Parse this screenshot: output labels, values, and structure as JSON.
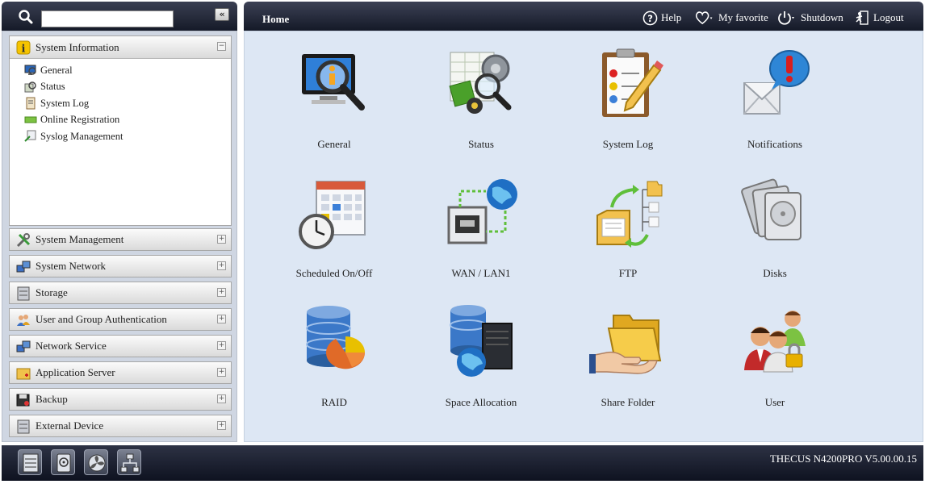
{
  "search": {
    "placeholder": "",
    "value": ""
  },
  "collapse_label": "«",
  "header": {
    "title": "Home",
    "help": "Help",
    "favorite": "My favorite",
    "shutdown": "Shutdown",
    "logout": "Logout"
  },
  "sidebar": {
    "active_section": {
      "label": "System Information",
      "toggle": "−",
      "items": [
        {
          "label": "General",
          "icon": "monitor-info-icon"
        },
        {
          "label": "Status",
          "icon": "status-icon"
        },
        {
          "label": "System Log",
          "icon": "log-icon"
        },
        {
          "label": "Online Registration",
          "icon": "register-icon"
        },
        {
          "label": "Syslog Management",
          "icon": "syslog-icon"
        }
      ]
    },
    "sections": [
      {
        "label": "System Management",
        "toggle": "+",
        "icon": "tools-icon"
      },
      {
        "label": "System Network",
        "toggle": "+",
        "icon": "network-icon"
      },
      {
        "label": "Storage",
        "toggle": "+",
        "icon": "storage-icon"
      },
      {
        "label": "User and Group Authentication",
        "toggle": "+",
        "icon": "users-icon"
      },
      {
        "label": "Network Service",
        "toggle": "+",
        "icon": "network-service-icon"
      },
      {
        "label": "Application Server",
        "toggle": "+",
        "icon": "app-server-icon"
      },
      {
        "label": "Backup",
        "toggle": "+",
        "icon": "backup-icon"
      },
      {
        "label": "External Device",
        "toggle": "+",
        "icon": "external-device-icon"
      }
    ]
  },
  "tiles": [
    {
      "label": "General",
      "icon": "general-icon"
    },
    {
      "label": "Status",
      "icon": "status-icon"
    },
    {
      "label": "System Log",
      "icon": "system-log-icon"
    },
    {
      "label": "Notifications",
      "icon": "notifications-icon"
    },
    {
      "label": "Scheduled On/Off",
      "icon": "schedule-icon"
    },
    {
      "label": "WAN / LAN1",
      "icon": "wan-lan-icon"
    },
    {
      "label": "FTP",
      "icon": "ftp-icon"
    },
    {
      "label": "Disks",
      "icon": "disks-icon"
    },
    {
      "label": "RAID",
      "icon": "raid-icon"
    },
    {
      "label": "Space Allocation",
      "icon": "space-allocation-icon"
    },
    {
      "label": "Share Folder",
      "icon": "share-folder-icon"
    },
    {
      "label": "User",
      "icon": "user-icon"
    }
  ],
  "bottom_bar": {
    "icons": [
      "server-icon",
      "disk-icon",
      "fan-icon",
      "network-tree-icon"
    ],
    "version": "THECUS N4200PRO V5.00.00.15"
  }
}
